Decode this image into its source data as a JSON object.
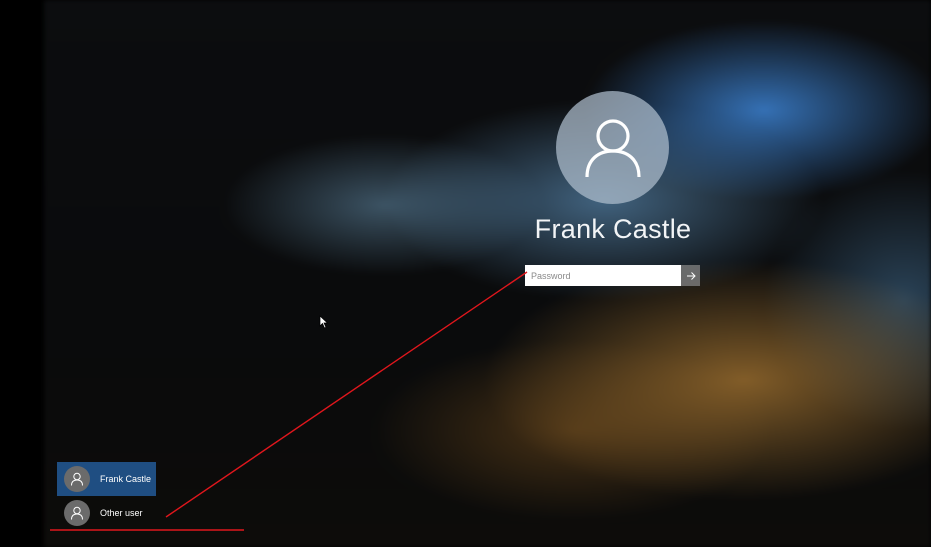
{
  "login": {
    "user_name": "Frank Castle",
    "password_placeholder": "Password",
    "avatar_icon": "user-icon",
    "submit_icon": "arrow-right-icon"
  },
  "user_list": [
    {
      "label": "Frank Castle",
      "selected": true,
      "icon": "user-icon"
    },
    {
      "label": "Other user",
      "selected": false,
      "icon": "user-icon"
    }
  ],
  "colors": {
    "selected_tile": "#1f4e82",
    "annotation": "#e0161c",
    "avatar_large": "#afbecd"
  }
}
